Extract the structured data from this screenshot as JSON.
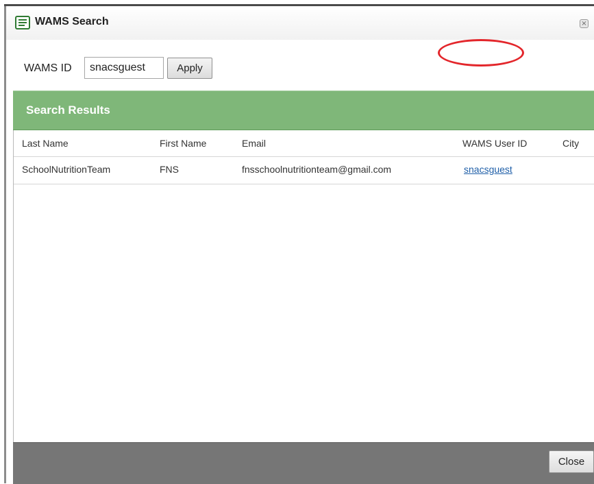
{
  "dialog": {
    "title": "WAMS Search",
    "icon": "list-document-icon",
    "accent_color": "#7fb779"
  },
  "filter": {
    "label": "WAMS ID",
    "value": "snacsguest",
    "apply_label": "Apply"
  },
  "results": {
    "title": "Search Results",
    "columns": [
      "Last Name",
      "First Name",
      "Email",
      "WAMS User ID",
      "City"
    ],
    "rows": [
      {
        "last_name": "SchoolNutritionTeam",
        "first_name": "FNS",
        "email": "fnsschoolnutritionteam@gmail.com",
        "wams_user_id": "snacsguest",
        "city": ""
      }
    ]
  },
  "footer": {
    "close_label": "Close"
  },
  "annotation_color": "#e3262b"
}
